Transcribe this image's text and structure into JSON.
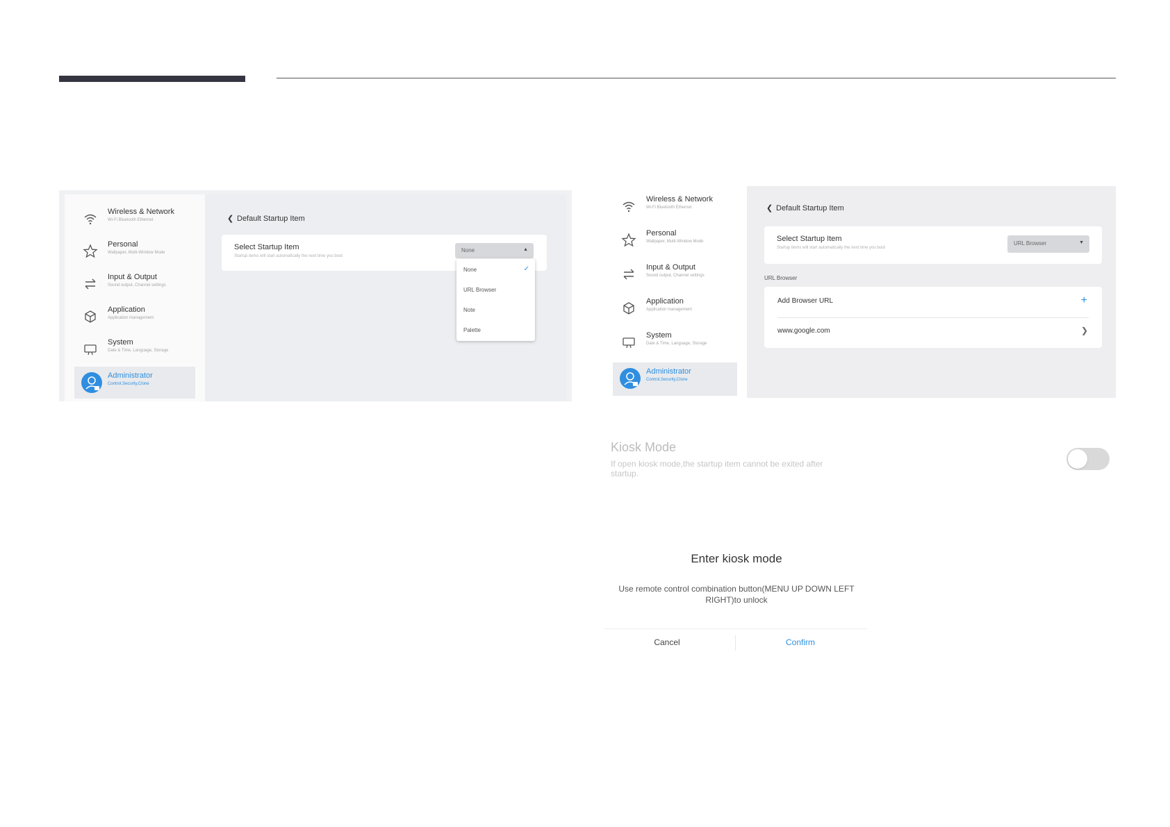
{
  "nav": [
    {
      "label": "Wireless & Network",
      "sub": "Wi-Fi Bluetooth Ethernet",
      "icon": "wifi-icon"
    },
    {
      "label": "Personal",
      "sub": "Wallpaper, Multi-Window Mode",
      "icon": "star-icon"
    },
    {
      "label": "Input & Output",
      "sub": "Sound output, Channel settings",
      "icon": "swap-arrows-icon"
    },
    {
      "label": "Application",
      "sub": "Application management",
      "icon": "cube-icon"
    },
    {
      "label": "System",
      "sub": "Date & Time, Language, Storage",
      "icon": "monitor-icon"
    },
    {
      "label": "Administrator",
      "sub": "Control,Security,Clone",
      "icon": "admin-avatar-icon"
    }
  ],
  "left_panel": {
    "back_title": "Default Startup Item",
    "card_title": "Select Startup Item",
    "card_sub": "Startup items will start automatically the next time you boot",
    "select_value": "None",
    "options": [
      "None",
      "URL Browser",
      "Note",
      "Palette"
    ]
  },
  "right_panel": {
    "back_title": "Default Startup Item",
    "card_title": "Select Startup Item",
    "card_sub": "Startup items will start automatically the next time you boot",
    "select_value": "URL Browser",
    "section_label": "URL Browser",
    "add_label": "Add Browser URL",
    "url_entry": "www.google.com"
  },
  "kiosk": {
    "title": "Kiosk Mode",
    "description": "If open kiosk mode,the startup item cannot be exited after startup.",
    "toggle_on": false
  },
  "dialog": {
    "title": "Enter kiosk mode",
    "message": "Use remote control combination button(MENU UP DOWN LEFT RIGHT)to unlock",
    "cancel": "Cancel",
    "confirm": "Confirm"
  },
  "colors": {
    "accent": "#2d8fe0",
    "header_bar": "#353541"
  }
}
